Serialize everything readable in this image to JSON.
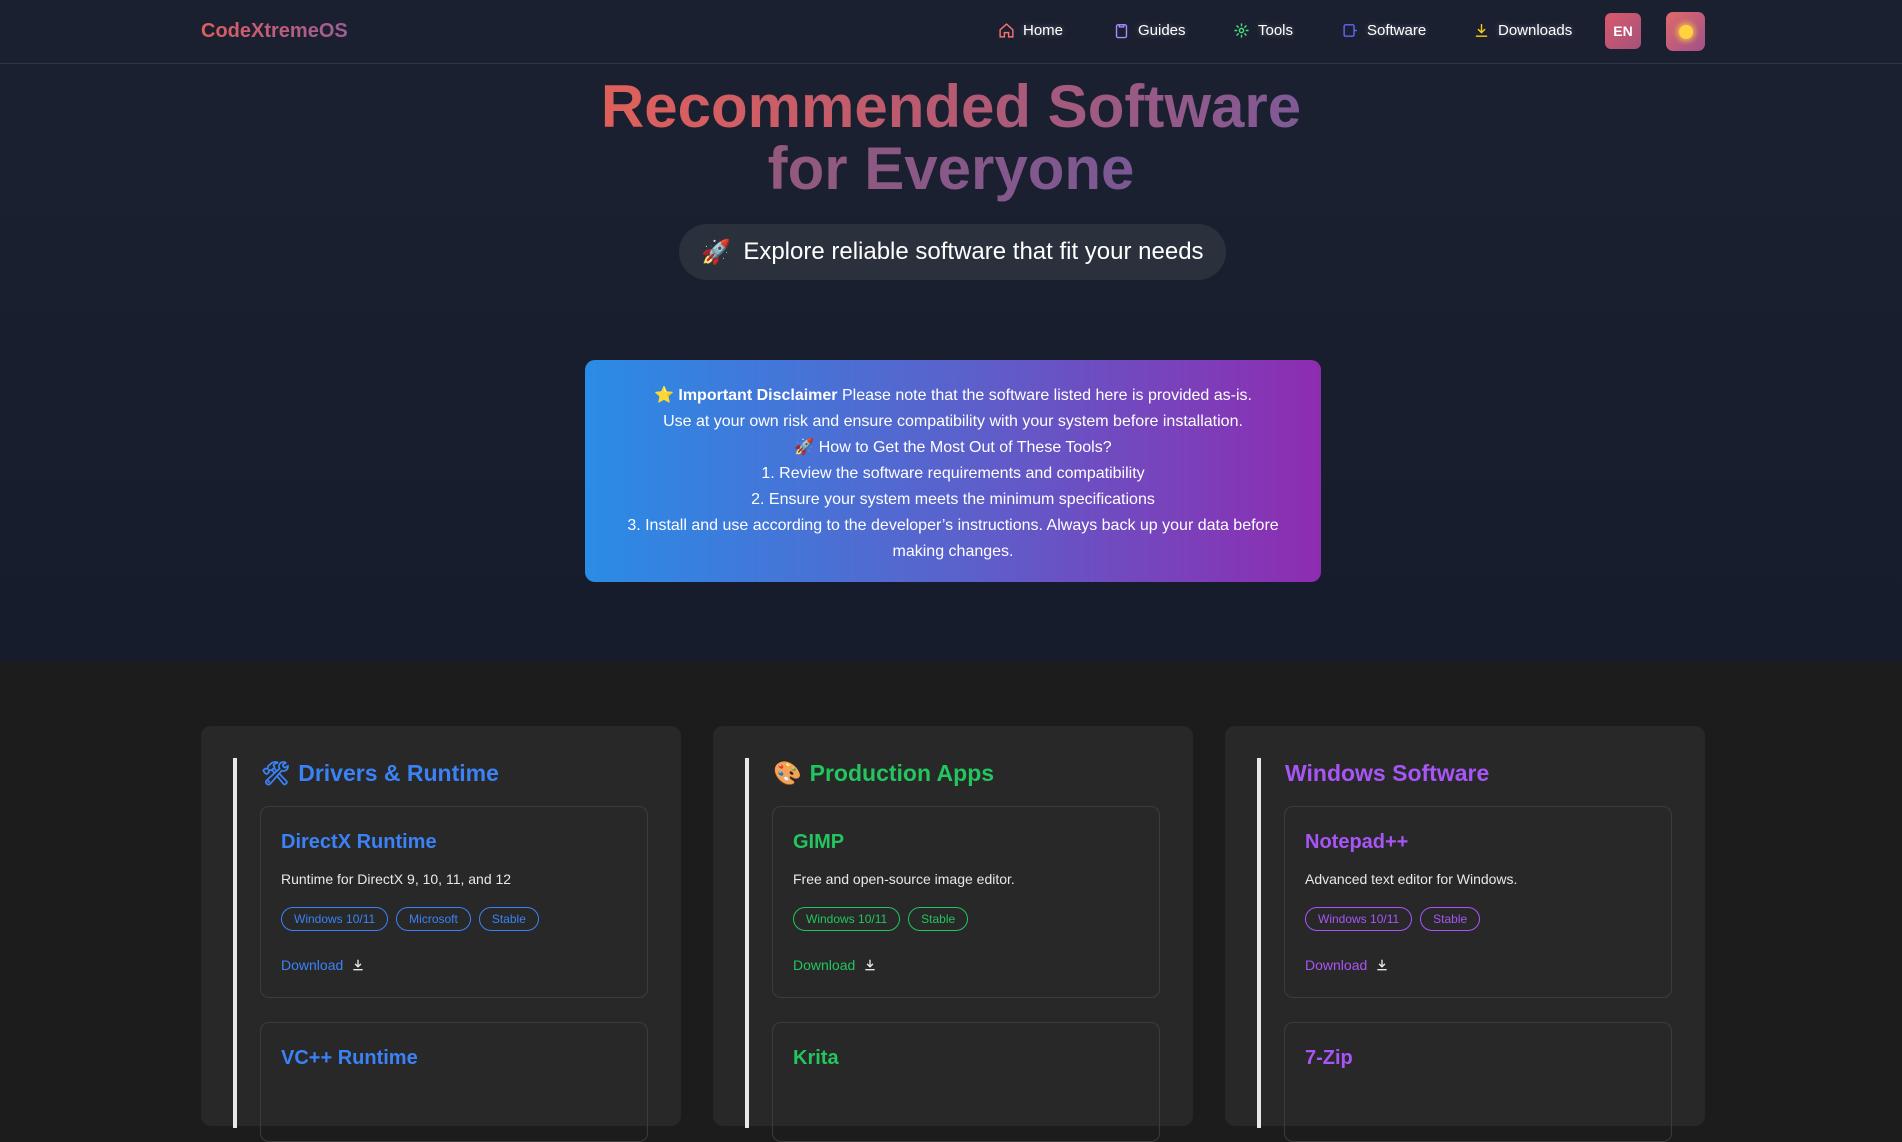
{
  "nav": {
    "brand": "CodeXtremeOS",
    "items": [
      {
        "label": "Home",
        "icon": "home-icon"
      },
      {
        "label": "Guides",
        "icon": "clipboard-icon"
      },
      {
        "label": "Tools",
        "icon": "gear-icon"
      },
      {
        "label": "Software",
        "icon": "window-icon"
      },
      {
        "label": "Downloads",
        "icon": "download-icon"
      }
    ],
    "lang": "EN",
    "theme_icon": "sun-icon"
  },
  "hero": {
    "title_line1": "Recommended Software",
    "title_line2": "for Everyone",
    "subtitle_emoji": "🚀",
    "subtitle": "Explore reliable software that fit your needs"
  },
  "disclaimer": {
    "star": "⭐",
    "heading": "Important Disclaimer",
    "text1": "Please note that the software listed here is provided as-is.",
    "text2": "Use at your own risk and ensure compatibility with your system before installation.",
    "rocket": "🚀",
    "howto": "How to Get the Most Out of These Tools?",
    "step1": "1. Review the software requirements and compatibility",
    "step2": "2. Ensure your system meets the minimum specifications",
    "step3": "3. Install and use according to the developer’s instructions. Always back up your data before making changes."
  },
  "columns": [
    {
      "title": "Drivers & Runtime",
      "icon": "🛠",
      "color": "#3b82f6",
      "cards": [
        {
          "title": "DirectX Runtime",
          "desc": "Runtime for DirectX 9, 10, 11, and 12",
          "tags": [
            "Windows 10/11",
            "Microsoft",
            "Stable"
          ],
          "download": "Download"
        },
        {
          "title": "VC++ Runtime"
        }
      ]
    },
    {
      "title": "Production Apps",
      "icon": "🎨",
      "color": "#22c55e",
      "cards": [
        {
          "title": "GIMP",
          "desc": "Free and open-source image editor.",
          "tags": [
            "Windows 10/11",
            "Stable"
          ],
          "download": "Download"
        },
        {
          "title": "Krita"
        }
      ]
    },
    {
      "title": "Windows Software",
      "icon": "",
      "color": "#a855f7",
      "cards": [
        {
          "title": "Notepad++",
          "desc": "Advanced text editor for Windows.",
          "tags": [
            "Windows 10/11",
            "Stable"
          ],
          "download": "Download"
        },
        {
          "title": "7-Zip"
        }
      ]
    }
  ]
}
